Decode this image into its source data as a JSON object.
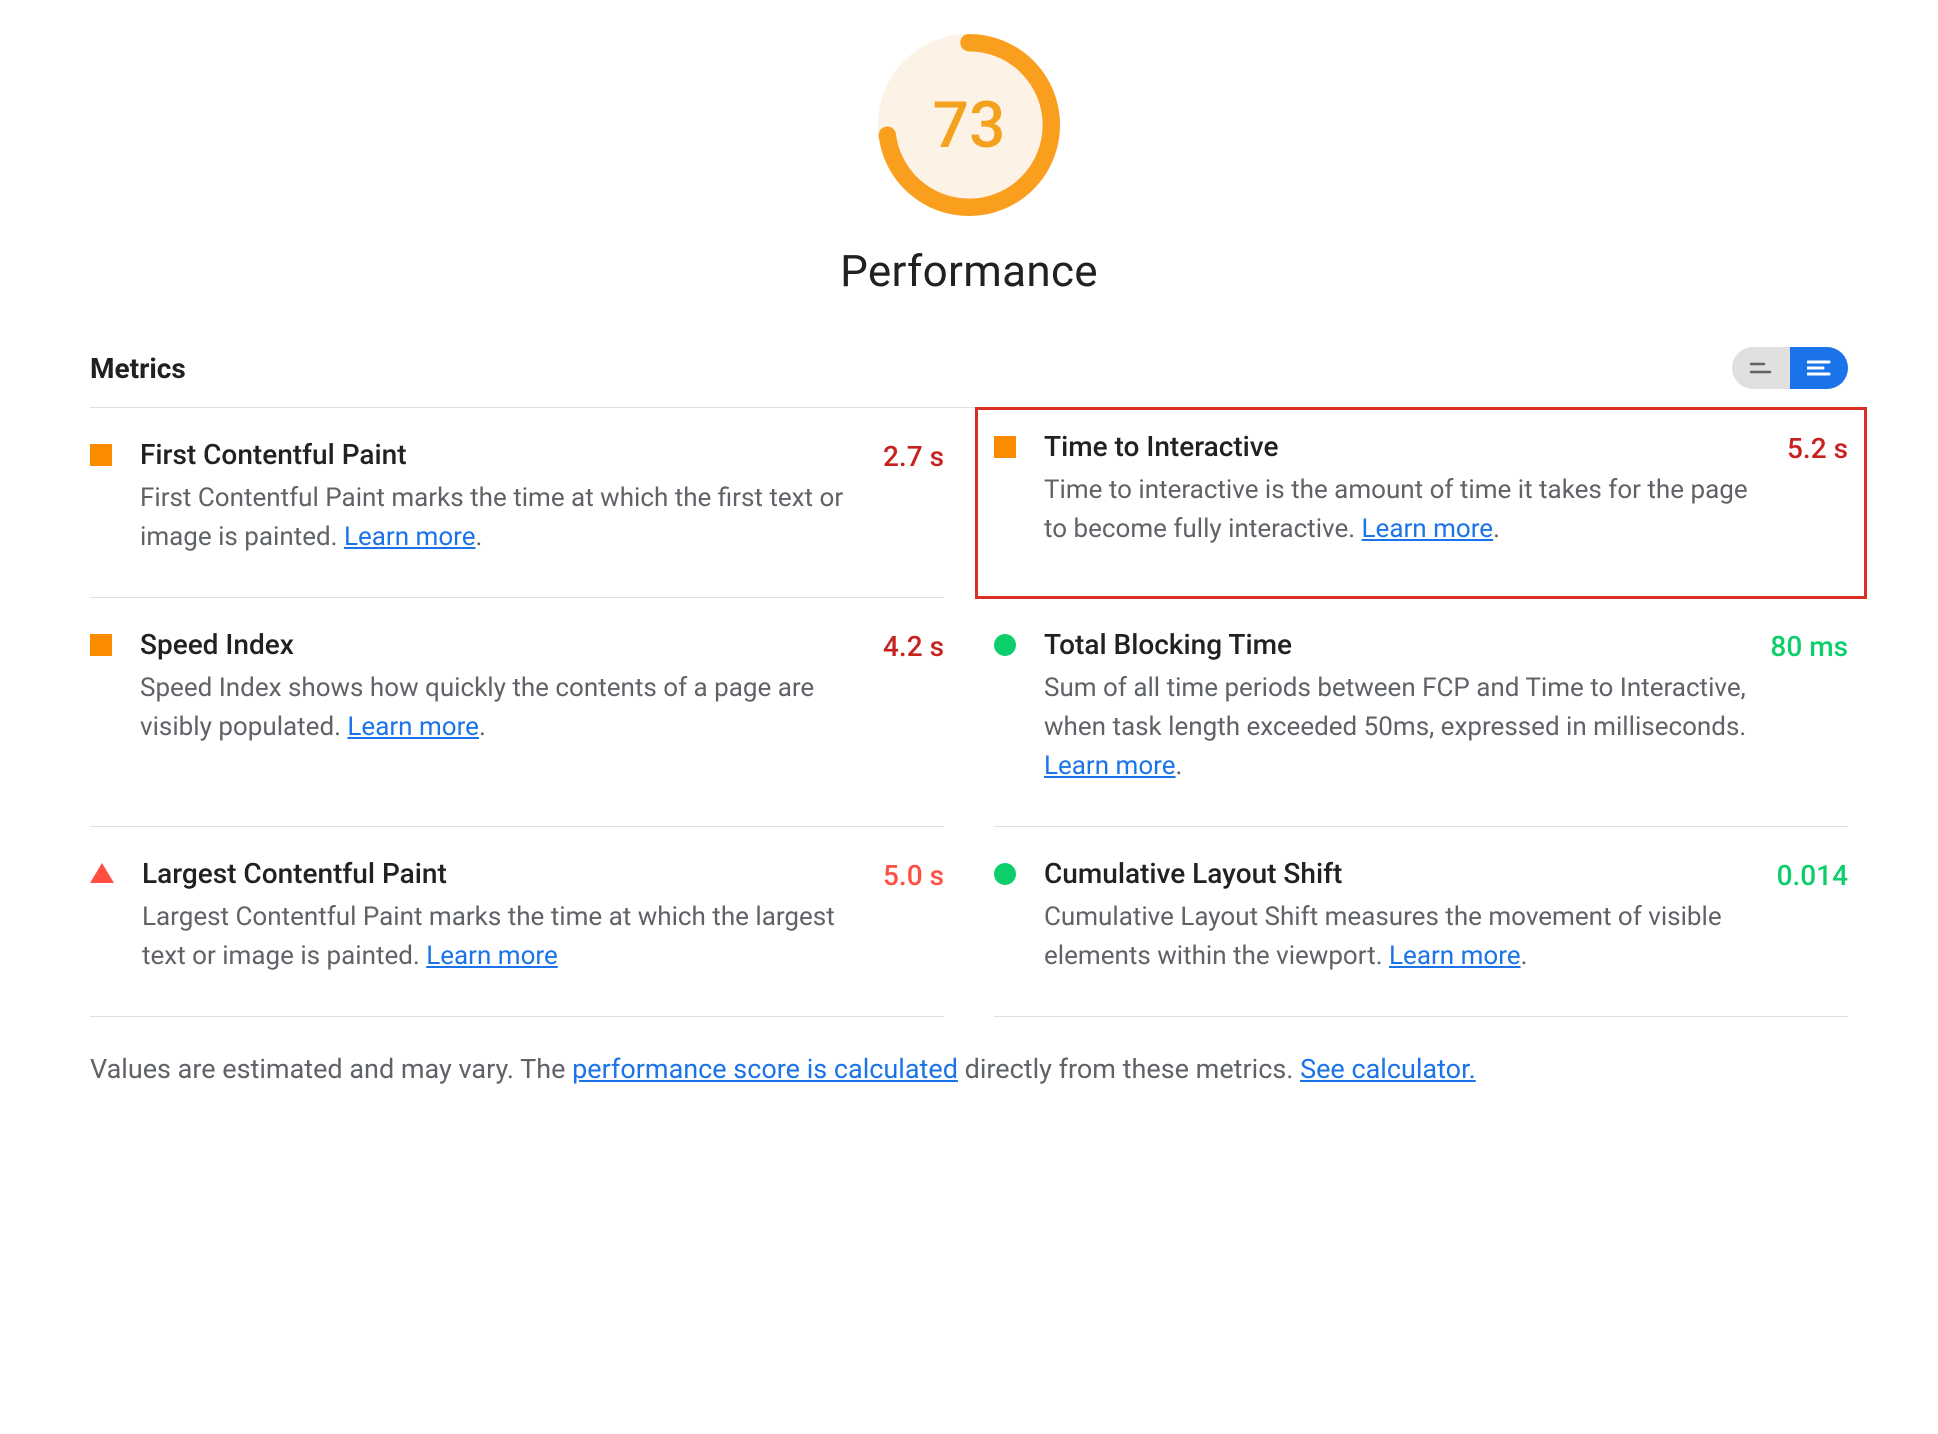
{
  "gauge": {
    "score": "73",
    "title": "Performance",
    "percent": 73
  },
  "section_title": "Metrics",
  "metrics": [
    {
      "id": "fcp",
      "title": "First Contentful Paint",
      "desc": "First Contentful Paint marks the time at which the first text or image is painted. ",
      "learn": "Learn more",
      "value": "2.7 s",
      "status": "average"
    },
    {
      "id": "tti",
      "title": "Time to Interactive",
      "desc": "Time to interactive is the amount of time it takes for the page to become fully interactive. ",
      "learn": "Learn more",
      "value": "5.2 s",
      "status": "average",
      "highlighted": true
    },
    {
      "id": "si",
      "title": "Speed Index",
      "desc": "Speed Index shows how quickly the contents of a page are visibly populated. ",
      "learn": "Learn more",
      "value": "4.2 s",
      "status": "average"
    },
    {
      "id": "tbt",
      "title": "Total Blocking Time",
      "desc": "Sum of all time periods between FCP and Time to Interactive, when task length exceeded 50ms, expressed in milliseconds. ",
      "learn": "Learn more",
      "value": "80 ms",
      "status": "good"
    },
    {
      "id": "lcp",
      "title": "Largest Contentful Paint",
      "desc": "Largest Contentful Paint marks the time at which the largest text or image is painted. ",
      "learn": "Learn more",
      "value": "5.0 s",
      "status": "poor"
    },
    {
      "id": "cls",
      "title": "Cumulative Layout Shift",
      "desc": "Cumulative Layout Shift measures the movement of visible elements within the viewport. ",
      "learn": "Learn more",
      "value": "0.014",
      "status": "good"
    }
  ],
  "footnote": {
    "prefix": "Values are estimated and may vary. The ",
    "link1": "performance score is calculated",
    "middle": " directly from these metrics. ",
    "link2": "See calculator."
  }
}
